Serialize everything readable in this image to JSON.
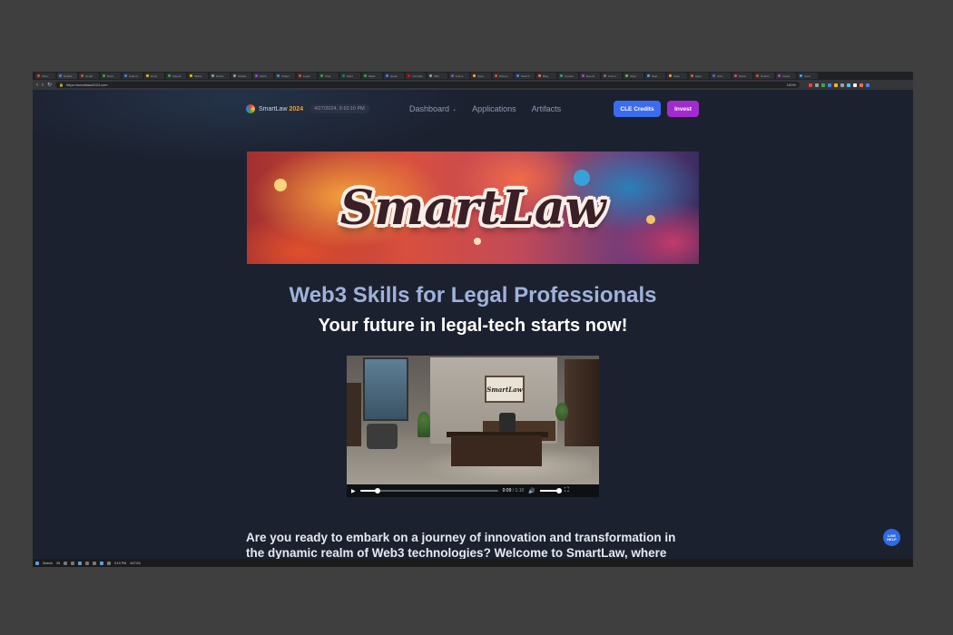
{
  "browser": {
    "tabs": [
      {
        "label": "Inbox",
        "color": "#e8453c"
      },
      {
        "label": "SmartL",
        "color": "#4285f4"
      },
      {
        "label": "Gmail",
        "color": "#e8453c"
      },
      {
        "label": "Docs",
        "color": "#34a853"
      },
      {
        "label": "Calend",
        "color": "#4285f4"
      },
      {
        "label": "Drive",
        "color": "#fbbc04"
      },
      {
        "label": "Sheets",
        "color": "#34a853"
      },
      {
        "label": "Slides",
        "color": "#fbbc04"
      },
      {
        "label": "Notion",
        "color": "#9aa0a6"
      },
      {
        "label": "GitHub",
        "color": "#9aa0a6"
      },
      {
        "label": "Web3",
        "color": "#a142f4"
      },
      {
        "label": "Twitter",
        "color": "#1da1f2"
      },
      {
        "label": "Legal",
        "color": "#e8453c"
      },
      {
        "label": "Chat",
        "color": "#34a853"
      },
      {
        "label": "Meet",
        "color": "#00897b"
      },
      {
        "label": "Maps",
        "color": "#34a853"
      },
      {
        "label": "News",
        "color": "#4285f4"
      },
      {
        "label": "YouTube",
        "color": "#ff0000"
      },
      {
        "label": "Wiki",
        "color": "#9aa0a6"
      },
      {
        "label": "Forms",
        "color": "#7e57c2"
      },
      {
        "label": "Keep",
        "color": "#fbbc04"
      },
      {
        "label": "Photos",
        "color": "#e8453c"
      },
      {
        "label": "Search",
        "color": "#4285f4"
      },
      {
        "label": "Blog",
        "color": "#ff7043"
      },
      {
        "label": "Course",
        "color": "#26a69a"
      },
      {
        "label": "Events",
        "color": "#ab47bc"
      },
      {
        "label": "Forum",
        "color": "#8d6e63"
      },
      {
        "label": "Shop",
        "color": "#66bb6a"
      },
      {
        "label": "Help",
        "color": "#42a5f5"
      },
      {
        "label": "Store",
        "color": "#ffa726"
      },
      {
        "label": "Apps",
        "color": "#ef5350"
      },
      {
        "label": "Jobs",
        "color": "#5c6bc0"
      },
      {
        "label": "Music",
        "color": "#ec407a"
      },
      {
        "label": "SmartL",
        "color": "#e8453c"
      },
      {
        "label": "Invest",
        "color": "#ab47bc"
      },
      {
        "label": "Cred",
        "color": "#42a5f5"
      }
    ],
    "url": "https://smartlaw2024.com",
    "zoom": "100%",
    "extension_colors": [
      "#e8453c",
      "#9aa0a6",
      "#34a853",
      "#4285f4",
      "#fbbc04",
      "#9aa0a6",
      "#4fc3f7",
      "#ffffff",
      "#ff7043",
      "#4285f4"
    ]
  },
  "site": {
    "brand_name": "SmartLaw",
    "brand_year": "2024",
    "date_time": "4/27/2024, 9:10:10 PM",
    "menu": {
      "dashboard": "Dashboard",
      "applications": "Applications",
      "artifacts": "Artifacts"
    },
    "cle_button": "CLE Credits",
    "invest_button": "Invest"
  },
  "banner": {
    "wordmark": "SmartLaw"
  },
  "hero": {
    "headline": "Web3 Skills for Legal Professionals",
    "subhead": "Your future in legal-tech starts now!"
  },
  "video": {
    "poster_sign": "SmartLaw",
    "current_time": "0:09",
    "duration": "1:10",
    "progress": 0.13,
    "volume": 1.0
  },
  "intro": {
    "line1": "Are you ready to embark on a journey of innovation and transformation in",
    "line2": "the dynamic realm of Web3 technologies? Welcome to SmartLaw, where"
  },
  "help": {
    "label_line1": "LIVE",
    "label_line2": "HELP"
  },
  "taskbar": {
    "search_label": "Search",
    "items": [
      "28",
      "",
      "",
      "",
      "",
      "",
      "",
      "",
      "",
      "9:10 PM",
      "4/27/24"
    ]
  }
}
